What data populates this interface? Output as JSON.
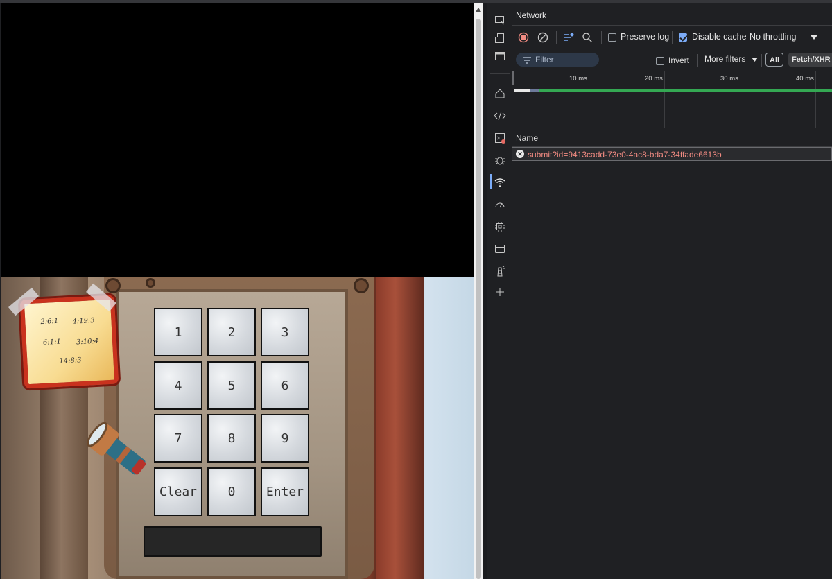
{
  "game": {
    "note_codes": [
      "2:6:1",
      "4:19:3",
      "6:1:1",
      "3:10:4",
      "14:8:3"
    ],
    "keys": [
      "1",
      "2",
      "3",
      "4",
      "5",
      "6",
      "7",
      "8",
      "9",
      "Clear",
      "0",
      "Enter"
    ],
    "display_value": ""
  },
  "devtools": {
    "panel_title": "Network",
    "toolbar": {
      "preserve_log": "Preserve log",
      "disable_cache": "Disable cache",
      "throttling": "No throttling"
    },
    "filter": {
      "placeholder": "Filter",
      "invert": "Invert",
      "more_filters": "More filters",
      "chip_all": "All",
      "chip_fetch": "Fetch/XHR"
    },
    "timeline_ticks": [
      "10 ms",
      "20 ms",
      "30 ms",
      "40 ms"
    ],
    "columns": {
      "name": "Name"
    },
    "requests": [
      {
        "name": "submit?id=9413cadd-73e0-4ac8-bda7-34ffade6613b",
        "status": "error"
      }
    ],
    "side_icons": [
      "inspect-icon",
      "device-icon",
      "window-icon",
      "home-icon",
      "code-icon",
      "console-icon",
      "bug-icon",
      "network-icon",
      "performance-icon",
      "memory-icon",
      "application-icon",
      "lighthouse-icon",
      "add-icon"
    ]
  },
  "colors": {
    "error_text": "#f28b82",
    "accent": "#7cacf8",
    "timeline_green": "#34a853",
    "record_red": "#f28b82"
  }
}
